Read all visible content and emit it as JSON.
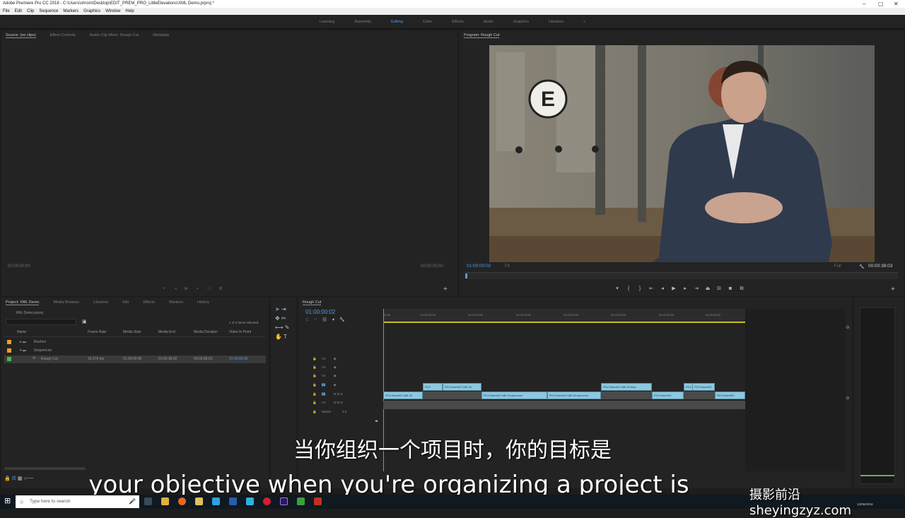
{
  "window": {
    "title": "Adobe Premiere Pro CC 2018 - C:\\Users\\shrom\\Desktop\\EDIT_PREM_PRO_LittleElevations\\XML Demo.prproj *"
  },
  "menu": [
    "File",
    "Edit",
    "Clip",
    "Sequence",
    "Markers",
    "Graphics",
    "Window",
    "Help"
  ],
  "workspaces": [
    {
      "label": "Learning"
    },
    {
      "label": "Assembly"
    },
    {
      "label": "Editing"
    },
    {
      "label": "Color"
    },
    {
      "label": "Effects"
    },
    {
      "label": "Audio"
    },
    {
      "label": "Graphics"
    },
    {
      "label": "Libraries"
    },
    {
      "label": "»"
    }
  ],
  "source_panel": {
    "tabs": [
      "Source: (no clips)",
      "Effect Controls",
      "Audio Clip Mixer: Rough Cut",
      "Metadata"
    ],
    "timecode_left": "00;00;00;00",
    "timecode_right": "00;00;00;00"
  },
  "program_panel": {
    "tab": "Program: Rough Cut",
    "timecode": "01:00:00:02",
    "fit": "Fit",
    "quality": "Full",
    "duration": "00:00:38:03"
  },
  "project_panel": {
    "tabs": [
      "Project: XML Demo",
      "Media Browser",
      "Libraries",
      "Info",
      "Effects",
      "Markers",
      "History"
    ],
    "project_file": "XML Demo.prproj",
    "items_selected": "1 of 3 items selected",
    "columns": [
      "Name",
      "Frame Rate",
      "Media Start",
      "Media End",
      "Media Duration",
      "Video In Point"
    ],
    "rows": [
      {
        "name": "Rushes"
      },
      {
        "name": "Sequences"
      },
      {
        "name": "Rough Cut",
        "frame_rate": "23.976 fps",
        "start": "01:00:00:00",
        "end": "01:00:38:02",
        "duration": "00:00:38:03",
        "in_point": "01:00:00:00"
      }
    ]
  },
  "timeline": {
    "tab": "Rough Cut",
    "timecode": "01:00:00:02",
    "ruler_labels": [
      "00:00",
      "01:00:05:00",
      "01:00:10:00",
      "01:00:15:00",
      "01:00:20:00",
      "01:00:25:00",
      "01:00:30:00",
      "01:00:35:00",
      "01:00:40:00",
      "01:00:45:00"
    ],
    "video_tracks": [
      "V4",
      "V3",
      "V2",
      "V1"
    ],
    "audio_tracks": [
      "A1",
      "A2"
    ],
    "master": "Master",
    "master_value": "0.0",
    "v2_clips": [
      "PC2",
      "PC4 DrumVO 180 10",
      "PC4 DrumVO 180 10.mov",
      "PC3 DrumVO",
      "PC3 DrumVO"
    ],
    "v1_clips": [
      "PC4 DrumVO 180 10",
      "PC4 DrumVO 180 10.mov.mov",
      "PC4 DrumVO 180 10.mov.mov",
      "PC4 DrumVO",
      "PC4 DrumVO"
    ]
  },
  "subtitles": {
    "zh": "当你组织一个项目时，你的目标是",
    "en": "your objective when you're organizing a project is"
  },
  "taskbar": {
    "search_placeholder": "Type here to search",
    "date": "12/06/2018"
  },
  "watermark": "摄影前沿 sheyingzyz.com"
}
